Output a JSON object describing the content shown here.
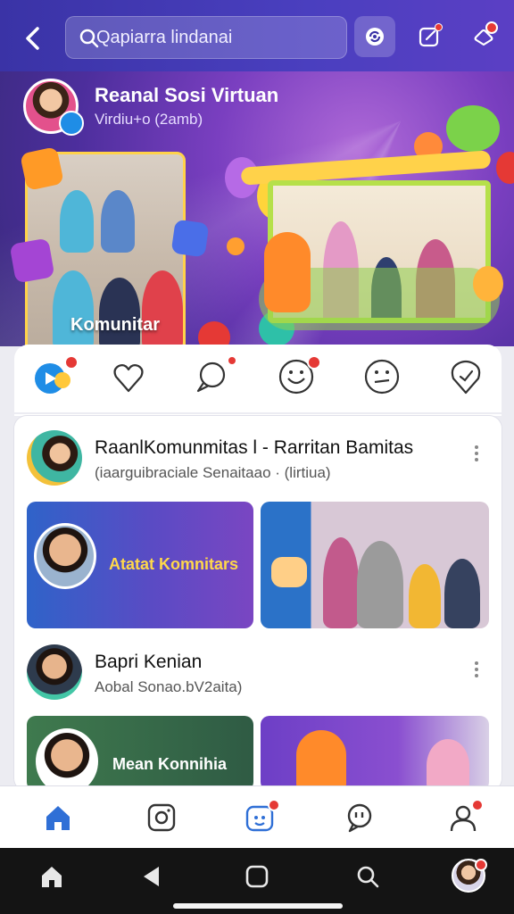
{
  "header": {
    "search_text": "Qapiarra lindanai",
    "accent_color": "#3a33a6",
    "icons": [
      "back-arrow-icon",
      "search-icon",
      "sync-icon",
      "edit-square-icon",
      "bell-icon"
    ]
  },
  "hero": {
    "title": "Reanal Sosi Virtuan",
    "subtitle": "Virdiu+o (2amb)",
    "card_label": "Komunitar",
    "background_color": "#7a3fc0"
  },
  "reactions": {
    "icons": [
      "video-chat-icon",
      "heart-icon",
      "comment-icon",
      "laugh-icon",
      "wow-icon",
      "location-icon"
    ],
    "badge_color": "#e53935"
  },
  "posts": [
    {
      "title": "RaanlKomunmitas l - Rarritan Bamitas",
      "subtitle": "(iaarguibraciale Senaitaao · (lirtiua)",
      "tiles": [
        {
          "label": "Atatat Komnitars"
        }
      ]
    },
    {
      "title": "Bapri Kenian",
      "subtitle": "Aobal Sonao.bV2aita)",
      "tiles": [
        {
          "label": "Mean Konnihia"
        }
      ]
    }
  ],
  "tabbar": {
    "icons": [
      "home-icon",
      "camera-icon",
      "reels-icon",
      "chat-icon",
      "profile-icon"
    ],
    "active_color": "#2f6fd6"
  },
  "system_nav": {
    "icons": [
      "home-icon",
      "back-triangle-icon",
      "recents-square-icon",
      "search-icon",
      "avatar"
    ]
  }
}
